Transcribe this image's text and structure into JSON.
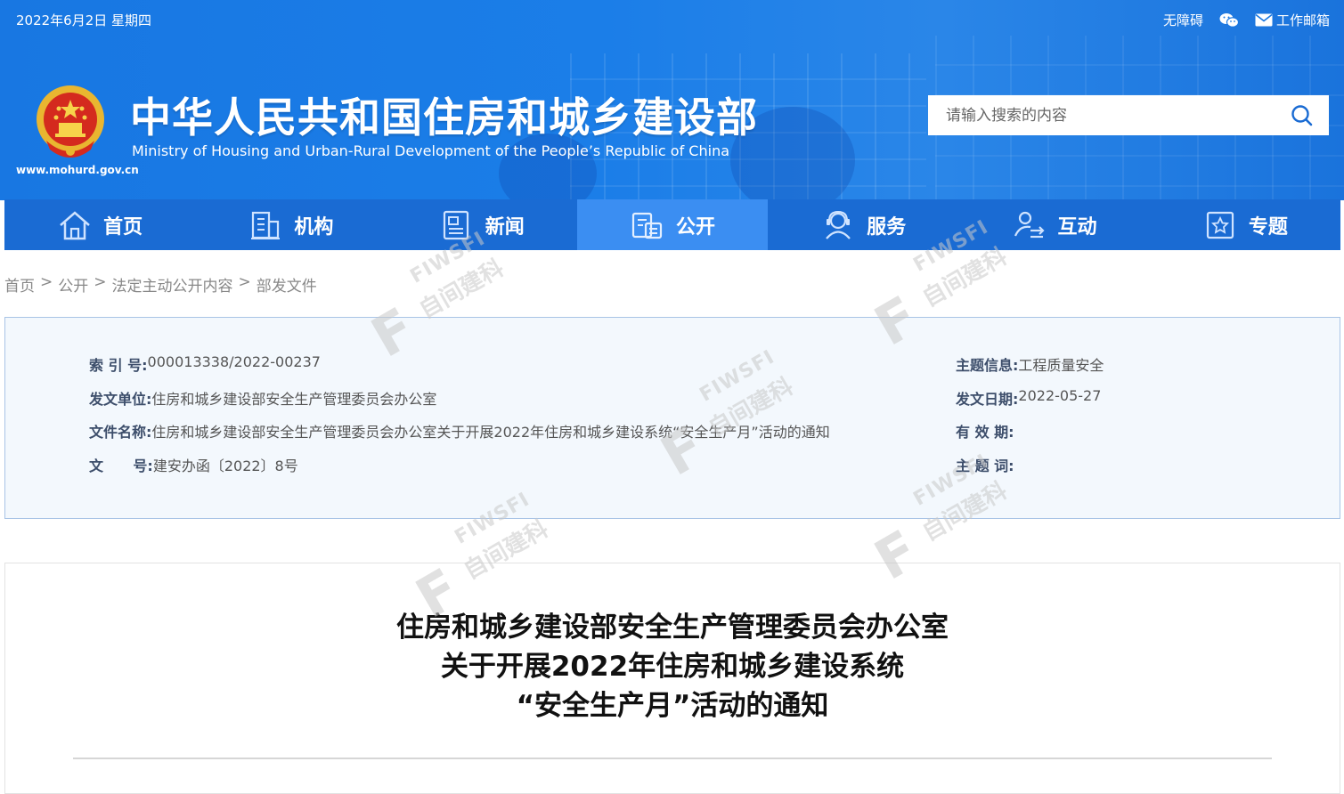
{
  "header": {
    "date": "2022年6月2日 星期四",
    "links": {
      "accessibility": "无障碍",
      "mailbox": "工作邮箱"
    },
    "site_url": "www.mohurd.gov.cn",
    "title": "中华人民共和国住房和城乡建设部",
    "subtitle": "Ministry of Housing and Urban-Rural Development of the People’s Republic of China",
    "search": {
      "placeholder": "请输入搜索的内容"
    }
  },
  "nav": {
    "items": [
      {
        "label": "首页",
        "icon": "home-icon"
      },
      {
        "label": "机构",
        "icon": "building-icon"
      },
      {
        "label": "新闻",
        "icon": "news-icon"
      },
      {
        "label": "公开",
        "icon": "disclosure-icon",
        "active": true
      },
      {
        "label": "服务",
        "icon": "service-icon"
      },
      {
        "label": "互动",
        "icon": "interaction-icon"
      },
      {
        "label": "专题",
        "icon": "topic-icon"
      }
    ]
  },
  "breadcrumb": {
    "items": [
      "首页",
      "公开",
      "法定主动公开内容",
      "部发文件"
    ],
    "separator": ">"
  },
  "meta": {
    "index_label": "索 引 号:",
    "index_value": "000013338/2022-00237",
    "issuer_label": "发文单位:",
    "issuer_value": "住房和城乡建设部安全生产管理委员会办公室",
    "filename_label": "文件名称:",
    "filename_value": "住房和城乡建设部安全生产管理委员会办公室关于开展2022年住房和城乡建设系统“安全生产月”活动的通知",
    "docnum_label": "文      号:",
    "docnum_value": "建安办函〔2022〕8号",
    "topic_label": "主题信息:",
    "topic_value": "工程质量安全",
    "date_label": "发文日期:",
    "date_value": "2022-05-27",
    "validity_label": "有 效 期:",
    "validity_value": "",
    "keywords_label": "主 题 词:",
    "keywords_value": ""
  },
  "document": {
    "title_line1": "住房和城乡建设部安全生产管理委员会办公室",
    "title_line2": "关于开展2022年住房和城乡建设系统",
    "title_line3": "“安全生产月”活动的通知"
  },
  "watermark": {
    "text_top": "FIWSFI",
    "text_bottom": "自间建科"
  },
  "colors": {
    "header_blue": "#1877e2",
    "nav_blue": "#1a6bd3",
    "nav_active": "#3b8ef2",
    "meta_bg": "#f3f8fd"
  }
}
